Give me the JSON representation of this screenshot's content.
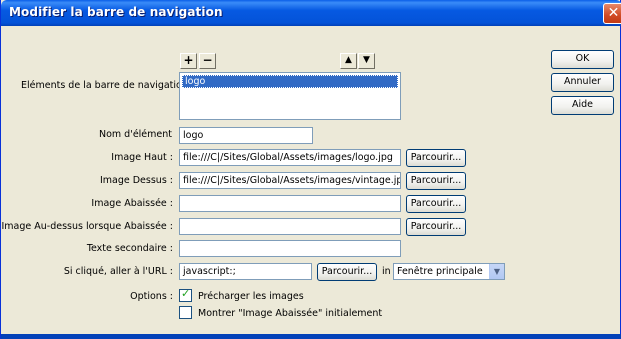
{
  "window": {
    "title": "Modifier la barre de navigation",
    "close_symbol": "✕"
  },
  "nav_bar": {
    "add_symbol": "+",
    "remove_symbol": "−",
    "move_up_symbol": "▲",
    "move_down_symbol": "▼",
    "elements_label": "Eléments de la barre de navigation",
    "elements": [
      "logo"
    ],
    "selected_element": "logo"
  },
  "form": {
    "element_name_label": "Nom d'élément",
    "element_name_value": "logo",
    "image_up_label": "Image Haut :",
    "image_up_value": "file:///C|/Sites/Global/Assets/images/logo.jpg",
    "image_over_label": "Image Dessus :",
    "image_over_value": "file:///C|/Sites/Global/Assets/images/vintage.jpg",
    "image_down_label": "Image Abaissée :",
    "image_down_value": "",
    "image_over_down_label": "Image Au-dessus lorsque Abaissée :",
    "image_over_down_value": "",
    "alt_text_label": "Texte secondaire :",
    "alt_text_value": "",
    "url_label": "Si cliqué, aller à l'URL :",
    "url_value": "javascript:;",
    "in_label": "in",
    "target_value": "Fenêtre principale",
    "browse_label": "Parcourir...",
    "options_label": "Options :",
    "preload_label": "Précharger les images",
    "preload_checked": true,
    "show_down_label": "Montrer \"Image Abaissée\" initialement",
    "show_down_checked": false
  },
  "buttons": {
    "ok": "OK",
    "cancel": "Annuler",
    "help": "Aide"
  }
}
